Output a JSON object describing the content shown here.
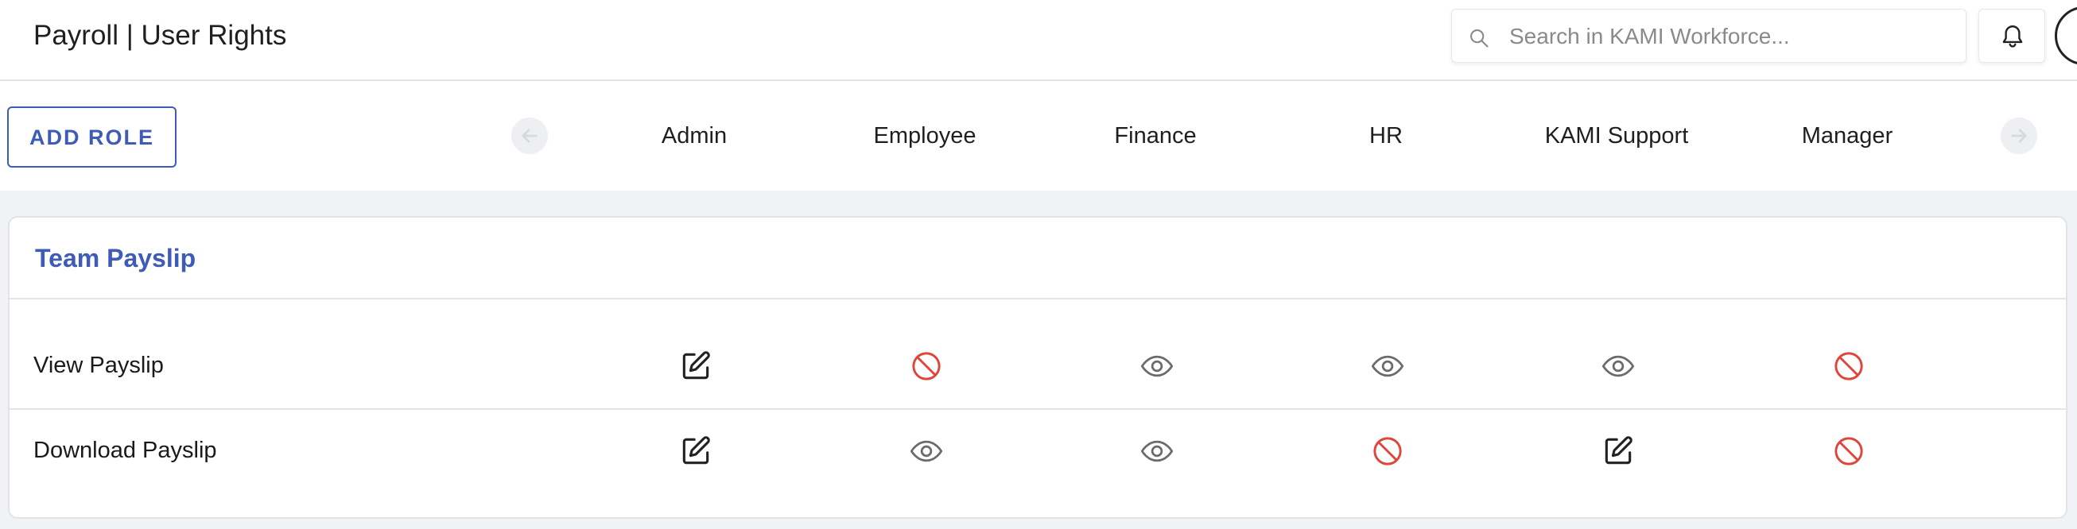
{
  "header": {
    "title": "Payroll | User Rights",
    "search_placeholder": "Search in KAMI Workforce..."
  },
  "toolbar": {
    "add_role_label": "ADD ROLE"
  },
  "roles": [
    "Admin",
    "Employee",
    "Finance",
    "HR",
    "KAMI Support",
    "Manager"
  ],
  "section": {
    "title": "Team Payslip",
    "permissions": [
      {
        "label": "View Payslip",
        "rights": [
          "edit",
          "none",
          "view",
          "view",
          "view",
          "none"
        ]
      },
      {
        "label": "Download Payslip",
        "rights": [
          "edit",
          "view",
          "view",
          "none",
          "edit",
          "none"
        ]
      }
    ]
  },
  "colors": {
    "accent": "#3f5bb8",
    "deny": "#e0453a",
    "view": "#6b6b6b",
    "edit": "#222222"
  },
  "icons": {
    "edit": "edit-icon",
    "view": "eye-icon",
    "none": "no-access-icon"
  }
}
